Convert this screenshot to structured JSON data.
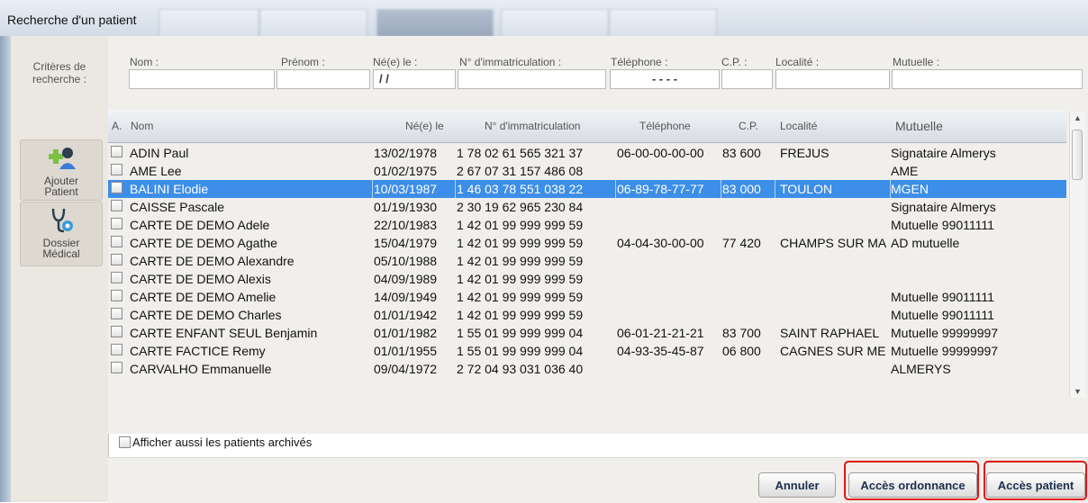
{
  "window": {
    "title": "Recherche d'un patient"
  },
  "sidebar": {
    "criteria_label_1": "Critères de",
    "criteria_label_2": "recherche :",
    "add_patient_1": "Ajouter",
    "add_patient_2": "Patient",
    "medical_file_1": "Dossier",
    "medical_file_2": "Médical",
    "icons": {
      "add_patient": "add-user-icon",
      "medical_file": "stethoscope-icon"
    }
  },
  "search": {
    "labels": {
      "nom": "Nom :",
      "prenom": "Prénom :",
      "ne_le": "Né(e) le :",
      "immat": "N° d'immatriculation :",
      "tel": "Téléphone :",
      "cp": "C.P. :",
      "localite": "Localité :",
      "mutuelle": "Mutuelle :"
    },
    "values": {
      "nom": "",
      "prenom": "",
      "ne_le": "/ /",
      "immat": "",
      "tel": "- - - -",
      "cp": "",
      "localite": "",
      "mutuelle": ""
    }
  },
  "table": {
    "headers": {
      "a": "A.",
      "nom": "Nom",
      "ne": "Né(e) le",
      "immat": "N° d'immatriculation",
      "tel": "Téléphone",
      "cp": "C.P.",
      "localite": "Localité",
      "mutuelle": "Mutuelle"
    },
    "selected_index": 2,
    "rows": [
      {
        "nom": "ADIN Paul",
        "ne": "13/02/1978",
        "immat": "1 78 02 61 565 321 37",
        "tel": "06-00-00-00-00",
        "cp": "83 600",
        "localite": "FREJUS",
        "mutuelle": "Signataire Almerys"
      },
      {
        "nom": "AME Lee",
        "ne": "01/02/1975",
        "immat": "2 67 07 31 157 486 08",
        "tel": "",
        "cp": "",
        "localite": "",
        "mutuelle": "AME"
      },
      {
        "nom": "BALINI Elodie",
        "ne": "10/03/1987",
        "immat": "1 46 03 78 551 038 22",
        "tel": "06-89-78-77-77",
        "cp": "83 000",
        "localite": "TOULON",
        "mutuelle": "MGEN"
      },
      {
        "nom": "CAISSE Pascale",
        "ne": "01/19/1930",
        "immat": "2 30 19 62 965 230 84",
        "tel": "",
        "cp": "",
        "localite": "",
        "mutuelle": "Signataire Almerys"
      },
      {
        "nom": "CARTE DE DEMO Adele",
        "ne": "22/10/1983",
        "immat": "1 42 01 99 999 999 59",
        "tel": "",
        "cp": "",
        "localite": "",
        "mutuelle": "Mutuelle 99011111"
      },
      {
        "nom": "CARTE DE DEMO Agathe",
        "ne": "15/04/1979",
        "immat": "1 42 01 99 999 999 59",
        "tel": "04-04-30-00-00",
        "cp": "77 420",
        "localite": "CHAMPS SUR MA",
        "mutuelle": "AD mutuelle"
      },
      {
        "nom": "CARTE DE DEMO Alexandre",
        "ne": "05/10/1988",
        "immat": "1 42 01 99 999 999 59",
        "tel": "",
        "cp": "",
        "localite": "",
        "mutuelle": ""
      },
      {
        "nom": "CARTE DE DEMO Alexis",
        "ne": "04/09/1989",
        "immat": "1 42 01 99 999 999 59",
        "tel": "",
        "cp": "",
        "localite": "",
        "mutuelle": ""
      },
      {
        "nom": "CARTE DE DEMO Amelie",
        "ne": "14/09/1949",
        "immat": "1 42 01 99 999 999 59",
        "tel": "",
        "cp": "",
        "localite": "",
        "mutuelle": "Mutuelle 99011111"
      },
      {
        "nom": "CARTE DE DEMO Charles",
        "ne": "01/01/1942",
        "immat": "1 42 01 99 999 999 59",
        "tel": "",
        "cp": "",
        "localite": "",
        "mutuelle": "Mutuelle 99011111"
      },
      {
        "nom": "CARTE ENFANT SEUL Benjamin",
        "ne": "01/01/1982",
        "immat": "1 55 01 99 999 999 04",
        "tel": "06-01-21-21-21",
        "cp": "83 700",
        "localite": "SAINT RAPHAEL",
        "mutuelle": "Mutuelle 99999997"
      },
      {
        "nom": "CARTE FACTICE Remy",
        "ne": "01/01/1955",
        "immat": "1 55 01 99 999 999 04",
        "tel": "04-93-35-45-87",
        "cp": "06 800",
        "localite": "CAGNES SUR ME",
        "mutuelle": "Mutuelle 99999997"
      },
      {
        "nom": "CARVALHO Emmanuelle",
        "ne": "09/04/1972",
        "immat": "2 72 04 93 031 036 40",
        "tel": "",
        "cp": "",
        "localite": "",
        "mutuelle": "ALMERYS"
      }
    ]
  },
  "options": {
    "archived_label": "Afficher aussi les patients archivés"
  },
  "buttons": {
    "cancel": "Annuler",
    "prescription": "Accès ordonnance",
    "patient": "Accès patient"
  },
  "colors": {
    "selection": "#3d8ee8",
    "highlight": "#e21414"
  }
}
